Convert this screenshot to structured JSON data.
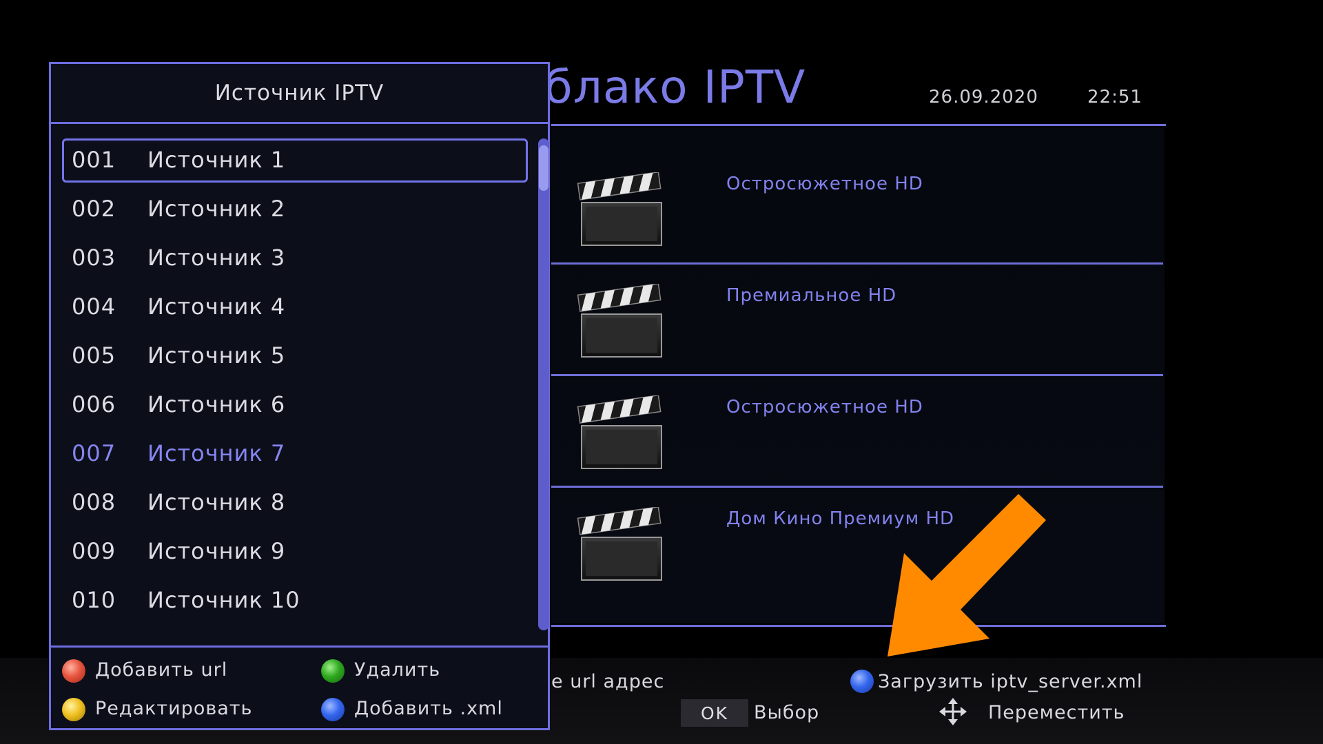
{
  "background": {
    "title": "блако IPTV",
    "date": "26.09.2020",
    "time": "22:51",
    "channels": [
      {
        "name": "Остросюжетное HD",
        "icon": "clapperboard-icon"
      },
      {
        "name": "Премиальное HD",
        "icon": "clapperboard-icon"
      },
      {
        "name": "Остросюжетное HD",
        "icon": "clapperboard-icon"
      },
      {
        "name": "Дом Кино Премиум HD",
        "icon": "clapperboard-icon"
      }
    ],
    "legend": {
      "url_text": "e url адрес",
      "load_xml": "Загрузить iptv_server.xml",
      "ok_key": "OK",
      "select": "Выбор",
      "move": "Переместить"
    }
  },
  "dialog": {
    "title": "Источник IPTV",
    "items": [
      {
        "num": "001",
        "label": "Источник 1"
      },
      {
        "num": "002",
        "label": "Источник 2"
      },
      {
        "num": "003",
        "label": "Источник 3"
      },
      {
        "num": "004",
        "label": "Источник 4"
      },
      {
        "num": "005",
        "label": "Источник 5"
      },
      {
        "num": "006",
        "label": "Источник 6"
      },
      {
        "num": "007",
        "label": "Источник 7"
      },
      {
        "num": "008",
        "label": "Источник 8"
      },
      {
        "num": "009",
        "label": "Источник 9"
      },
      {
        "num": "010",
        "label": "Источник 10"
      }
    ],
    "selected_index": 0,
    "highlighted_index": 6,
    "footer": {
      "add_url": "Добавить url",
      "delete": "Удалить",
      "edit": "Редактировать",
      "add_xml": "Добавить .xml"
    }
  },
  "colors": {
    "accent": "#6e6ee0",
    "highlight_text": "#8686f0",
    "arrow": "#ff8a00",
    "red_key": "#e6553f",
    "green_key": "#2fa81f",
    "yellow_key": "#f0c020",
    "blue_key": "#3366ee"
  }
}
